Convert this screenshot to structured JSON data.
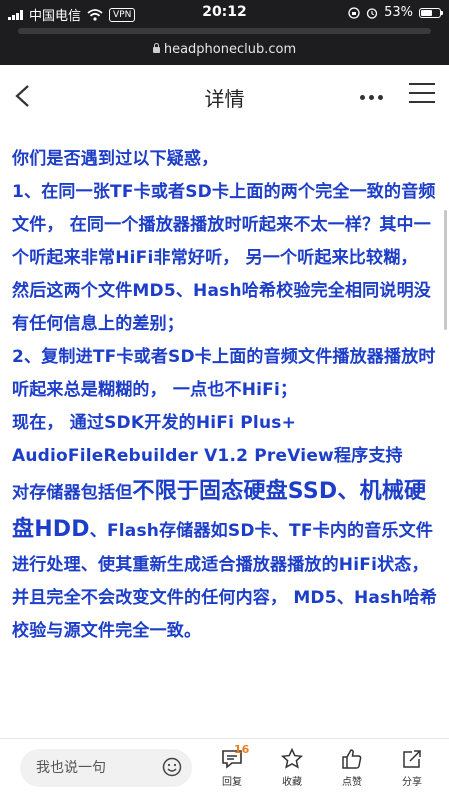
{
  "status_bar": {
    "carrier": "中国电信",
    "vpn": "VPN",
    "time": "20:12",
    "battery": "53%"
  },
  "browser": {
    "url": "headphoneclub.com"
  },
  "header": {
    "title": "详情",
    "more_icon": "more-dots-icon",
    "menu_icon": "hamburger-menu-icon",
    "back_icon": "back-chevron-icon"
  },
  "article": {
    "text_color": "#1d3ec9",
    "lines": [
      "你们是否遇到过以下疑惑，",
      "1、在同一张TF卡或者SD卡上面的两个完全一致的音频文件，  在同一个播放器播放时听起来不太一样？其中一个听起来非常HiFi非常好听，  另一个听起来比较糊，  然后这两个文件MD5、Hash哈希校验完全相同说明没有任何信息上的差别；",
      "2、复制进TF卡或者SD卡上面的音频文件播放器播放时听起来总是糊糊的，  一点也不HiFi；",
      "现在，  通过SDK开发的HiFi Plus+ AudioFileRebuilder V1.2 PreView程序支持"
    ],
    "mixed_prefix": "对存储器包括但",
    "mixed_big_1": "不限于固态硬盘SSD、",
    "mixed_big_2": "机械硬盘HDD",
    "mixed_suffix": "、Flash存储器如SD卡、TF卡内的音乐文件进行处理、使其重新生成适合播放器播放的HiFi状态，  并且完全不会改变文件的任何内容，  MD5、Hash哈希校验与源文件完全一致。"
  },
  "bottom_bar": {
    "comment_placeholder": "我也说一句",
    "reply_label": "回复",
    "reply_count": "16",
    "favorite_label": "收藏",
    "like_label": "点赞",
    "share_label": "分享",
    "badge_color": "#f07a1a"
  }
}
